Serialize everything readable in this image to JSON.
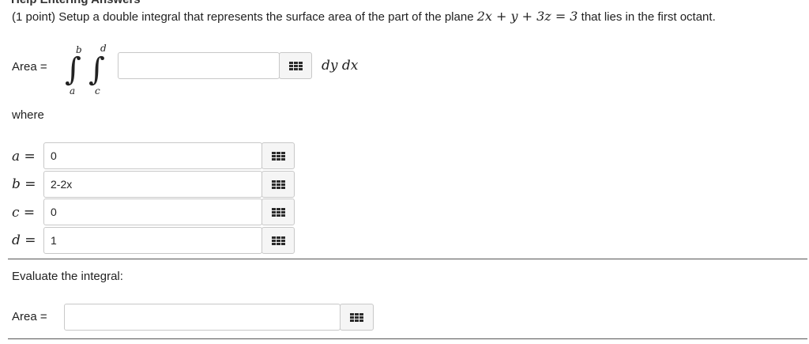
{
  "header": {
    "cropped_title": "Help Entering Answers"
  },
  "problem": {
    "prefix": "(1 point) Setup a double integral that represents the surface area of the part of the plane ",
    "equation": "2x + y + 3z = 3",
    "suffix": " that lies in the first octant."
  },
  "integral": {
    "area_label": "Area =",
    "outer_upper": "b",
    "outer_lower": "a",
    "inner_upper": "d",
    "inner_lower": "c",
    "integrand_value": "",
    "differentials": "dy dx"
  },
  "where_label": "where",
  "limits": [
    {
      "label": "a =",
      "value": "0"
    },
    {
      "label": "b =",
      "value": "2-2x"
    },
    {
      "label": "c =",
      "value": "0"
    },
    {
      "label": "d =",
      "value": "1"
    }
  ],
  "evaluate": {
    "heading": "Evaluate the integral:",
    "area_label": "Area =",
    "value": ""
  },
  "icons": {
    "palette": "equation-editor-grid-icon"
  }
}
